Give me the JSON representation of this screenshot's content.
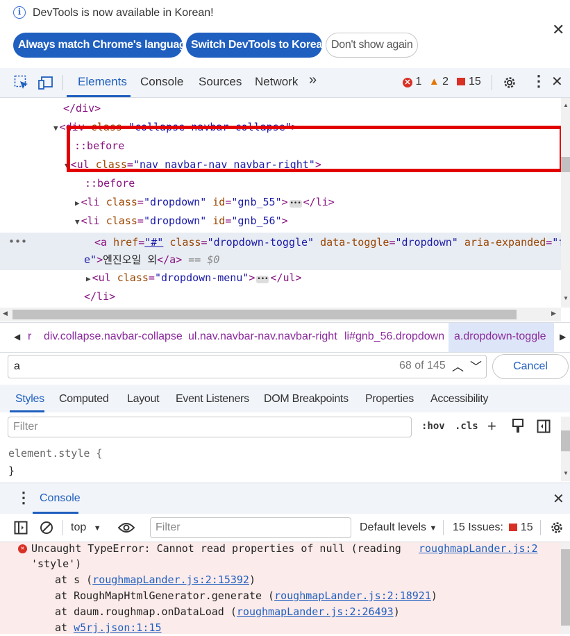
{
  "infobar": {
    "message": "DevTools is now available in Korean!",
    "btn_match": "Always match Chrome's language",
    "btn_switch": "Switch DevTools to Korean",
    "btn_dont_show": "Don't show again"
  },
  "toolbar": {
    "tabs": [
      "Elements",
      "Console",
      "Sources",
      "Network"
    ],
    "more": "»",
    "errors": "1",
    "warnings": "2",
    "issues": "15"
  },
  "dom_tree": {
    "line1": "</div>",
    "line2_tag": "<div ",
    "line2_attr": "class",
    "line2_val": "\"collapse navbar-collapse\"",
    "line3": "::before",
    "line4_tag": "<ul ",
    "line4_attr": "class",
    "line4_val": "\"nav navbar-nav navbar-right\"",
    "line5": "::before",
    "line6_attr": "class",
    "line6_val": "\"dropdown\"",
    "line6_attr2": "id",
    "line6_val2": "\"gnb_55\"",
    "line7_attr": "class",
    "line7_val": "\"dropdown\"",
    "line7_attr2": "id",
    "line7_val2": "\"gnb_56\"",
    "sel_a_attr1": "href",
    "sel_a_val1": "\"#\"",
    "sel_a_attr2": "class",
    "sel_a_val2": "\"dropdown-toggle\"",
    "sel_a_attr3": "data-toggle",
    "sel_a_val3": "\"dropdown\"",
    "sel_a_attr4": "aria-expanded",
    "sel_a_val4_start": "\"fals",
    "sel_a_val4_end": "e\"",
    "sel_a_text": "엔진오일 외",
    "sel_a_marker": "== $0",
    "line9_attr": "class",
    "line9_val": "\"dropdown-menu\"",
    "line10": "</li>"
  },
  "breadcrumbs": [
    "r",
    "div.collapse.navbar-collapse",
    "ul.nav.navbar-nav.navbar-right",
    "li#gnb_56.dropdown",
    "a.dropdown-toggle"
  ],
  "search": {
    "value": "a",
    "count": "68 of 145",
    "cancel": "Cancel"
  },
  "styles_tabs": [
    "Styles",
    "Computed",
    "Layout",
    "Event Listeners",
    "DOM Breakpoints",
    "Properties",
    "Accessibility"
  ],
  "styles_filter": {
    "placeholder": "Filter",
    "hov": ":hov",
    "cls": ".cls"
  },
  "element_style": {
    "selector": "element.style {",
    "close": "}"
  },
  "drawer": {
    "title": "Console",
    "context": "top",
    "filter_placeholder": "Filter",
    "levels": "Default levels",
    "issues_label": "15 Issues:",
    "issues_count": "15"
  },
  "error": {
    "message1": "Uncaught TypeError: Cannot read properties of null (reading",
    "message2": "'style')",
    "source": "roughmapLander.js:2",
    "stack1_prefix": "at s (",
    "stack1_link": "roughmapLander.js:2:15392",
    "stack2_prefix": "at RoughMapHtmlGenerator.generate (",
    "stack2_link": "roughmapLander.js:2:18921",
    "stack3_prefix": "at daum.roughmap.onDataLoad (",
    "stack3_link": "roughmapLander.js:2:26493",
    "stack4_prefix": "at ",
    "stack4_link": "w5rj.json:1:15"
  },
  "colors": {
    "accent": "#1f5fbf",
    "highlight_border": "#e20000",
    "error_bg": "#fcebeb"
  }
}
